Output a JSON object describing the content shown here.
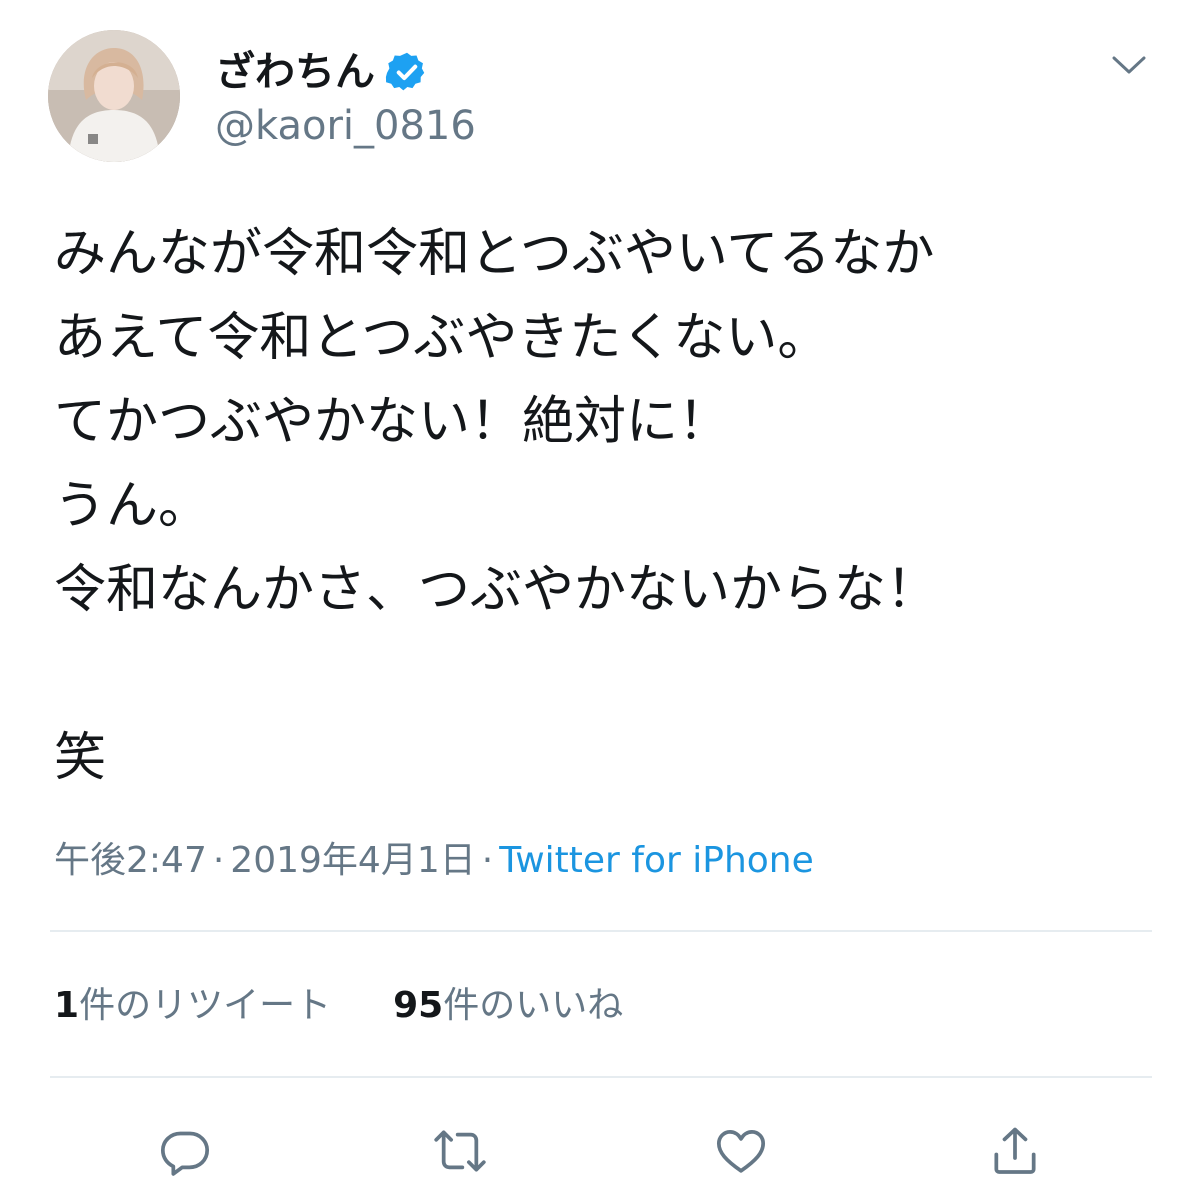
{
  "user": {
    "display_name": "ざわちん",
    "handle": "@kaori_0816",
    "verified": true
  },
  "tweet": {
    "text": "みんなが令和令和とつぶやいてるなか\nあえて令和とつぶやきたくない。\nてかつぶやかない！絶対に！\nうん。\n令和なんかさ、つぶやかないからな！\n\n笑"
  },
  "meta": {
    "time": "午後2:47",
    "separator": "·",
    "date": "2019年4月1日",
    "source": "Twitter for iPhone"
  },
  "stats": {
    "retweet_count": "1",
    "retweet_label": "件のリツイート",
    "like_count": "95",
    "like_label": "件のいいね"
  },
  "icons": {
    "verified": "verified-badge-icon",
    "menu": "chevron-down-icon",
    "reply": "reply-icon",
    "retweet": "retweet-icon",
    "like": "heart-icon",
    "share": "share-icon"
  },
  "colors": {
    "text": "#14171a",
    "secondary": "#657786",
    "link": "#1b95e0",
    "verified": "#1da1f2",
    "divider": "#e6ecf0"
  }
}
